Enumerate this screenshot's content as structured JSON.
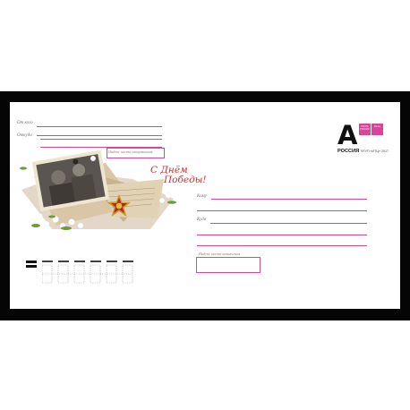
{
  "envelope": {
    "sender": {
      "from_label": "От кого",
      "from_where_label": "Откуда",
      "index_label": "Индекс места отправления"
    },
    "greeting": {
      "line1": "С Днём",
      "line2": "Победы!"
    },
    "stamp": {
      "letter": "А",
      "country": "РОССИЯ",
      "code": "ФГУП «ИТЦ» 2017",
      "badge1": "ПОЧТА РОССИИ",
      "badge2": "Почта"
    },
    "recipient": {
      "to_label": "Кому",
      "to_where_label": "Куда",
      "index_label": "Индекс места назначения"
    },
    "colors": {
      "accent": "#d9459a",
      "greeting": "#d8282c",
      "frame": "#050505"
    }
  }
}
